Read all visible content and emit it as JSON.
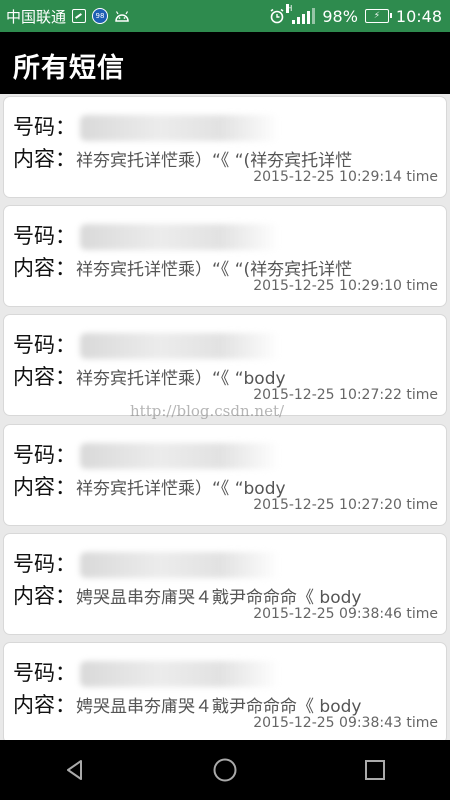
{
  "status_bar": {
    "carrier": "中国联通",
    "badge": "98",
    "network": "H",
    "battery_percent": "98%",
    "time": "10:48",
    "background_color": "#2e8b4e"
  },
  "header": {
    "title": "所有短信"
  },
  "labels": {
    "number": "号码：",
    "content": "内容："
  },
  "messages": [
    {
      "body": "祥夯宾托详恾乘）“《 “(祥夯宾托详恾",
      "time": "2015-12-25 10:29:14 time"
    },
    {
      "body": "祥夯宾托详恾乘）“《 “(祥夯宾托详恾",
      "time": "2015-12-25 10:29:10 time"
    },
    {
      "body": "祥夯宾托详恾乘）“《 “body",
      "time": "2015-12-25 10:27:22 time"
    },
    {
      "body": "祥夯宾托详恾乘）“《 “body",
      "time": "2015-12-25 10:27:20 time"
    },
    {
      "body": "娉哭昷串夯庯哭４戭尹命命命《 body",
      "time": "2015-12-25 09:38:46 time"
    },
    {
      "body": "娉哭昷串夯庯哭４戭尹命命命《 body",
      "time": "2015-12-25 09:38:43 time"
    }
  ],
  "watermark": "http://blog.csdn.net/",
  "nav": {
    "back_icon": "back-triangle-icon",
    "home_icon": "home-circle-icon",
    "recent_icon": "recent-square-icon"
  }
}
